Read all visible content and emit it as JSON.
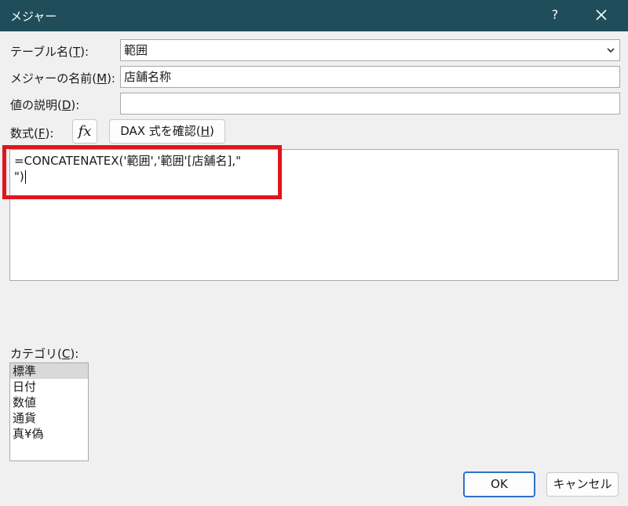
{
  "window": {
    "title": "メジャー",
    "help_glyph": "?",
    "close_glyph": "✕"
  },
  "table_name": {
    "label_pre": "テーブル名(",
    "label_key": "T",
    "label_post": "):",
    "value": "範囲"
  },
  "measure_name": {
    "label_pre": "メジャーの名前(",
    "label_key": "M",
    "label_post": "):",
    "value": "店舗名称"
  },
  "description": {
    "label_pre": "値の説明(",
    "label_key": "D",
    "label_post": "):",
    "value": ""
  },
  "formula": {
    "label_pre": "数式(",
    "label_key": "F",
    "label_post": "):",
    "fx_label": "fx",
    "check_button": {
      "label_pre": "DAX 式を確認(",
      "label_key": "H",
      "label_post": ")"
    },
    "line1": "=CONCATENATEX('範囲','範囲'[店舗名],\"",
    "line2": "\")"
  },
  "category": {
    "label_pre": "カテゴリ(",
    "label_key": "C",
    "label_post": "):",
    "items": [
      "標準",
      "日付",
      "数値",
      "通貨",
      "真¥偽"
    ],
    "selected_index": 0
  },
  "buttons": {
    "ok": "OK",
    "cancel": "キャンセル"
  },
  "colors": {
    "titlebar": "#1f4e5a",
    "highlight_border": "#e0151d",
    "ok_border": "#2f6fcf"
  }
}
